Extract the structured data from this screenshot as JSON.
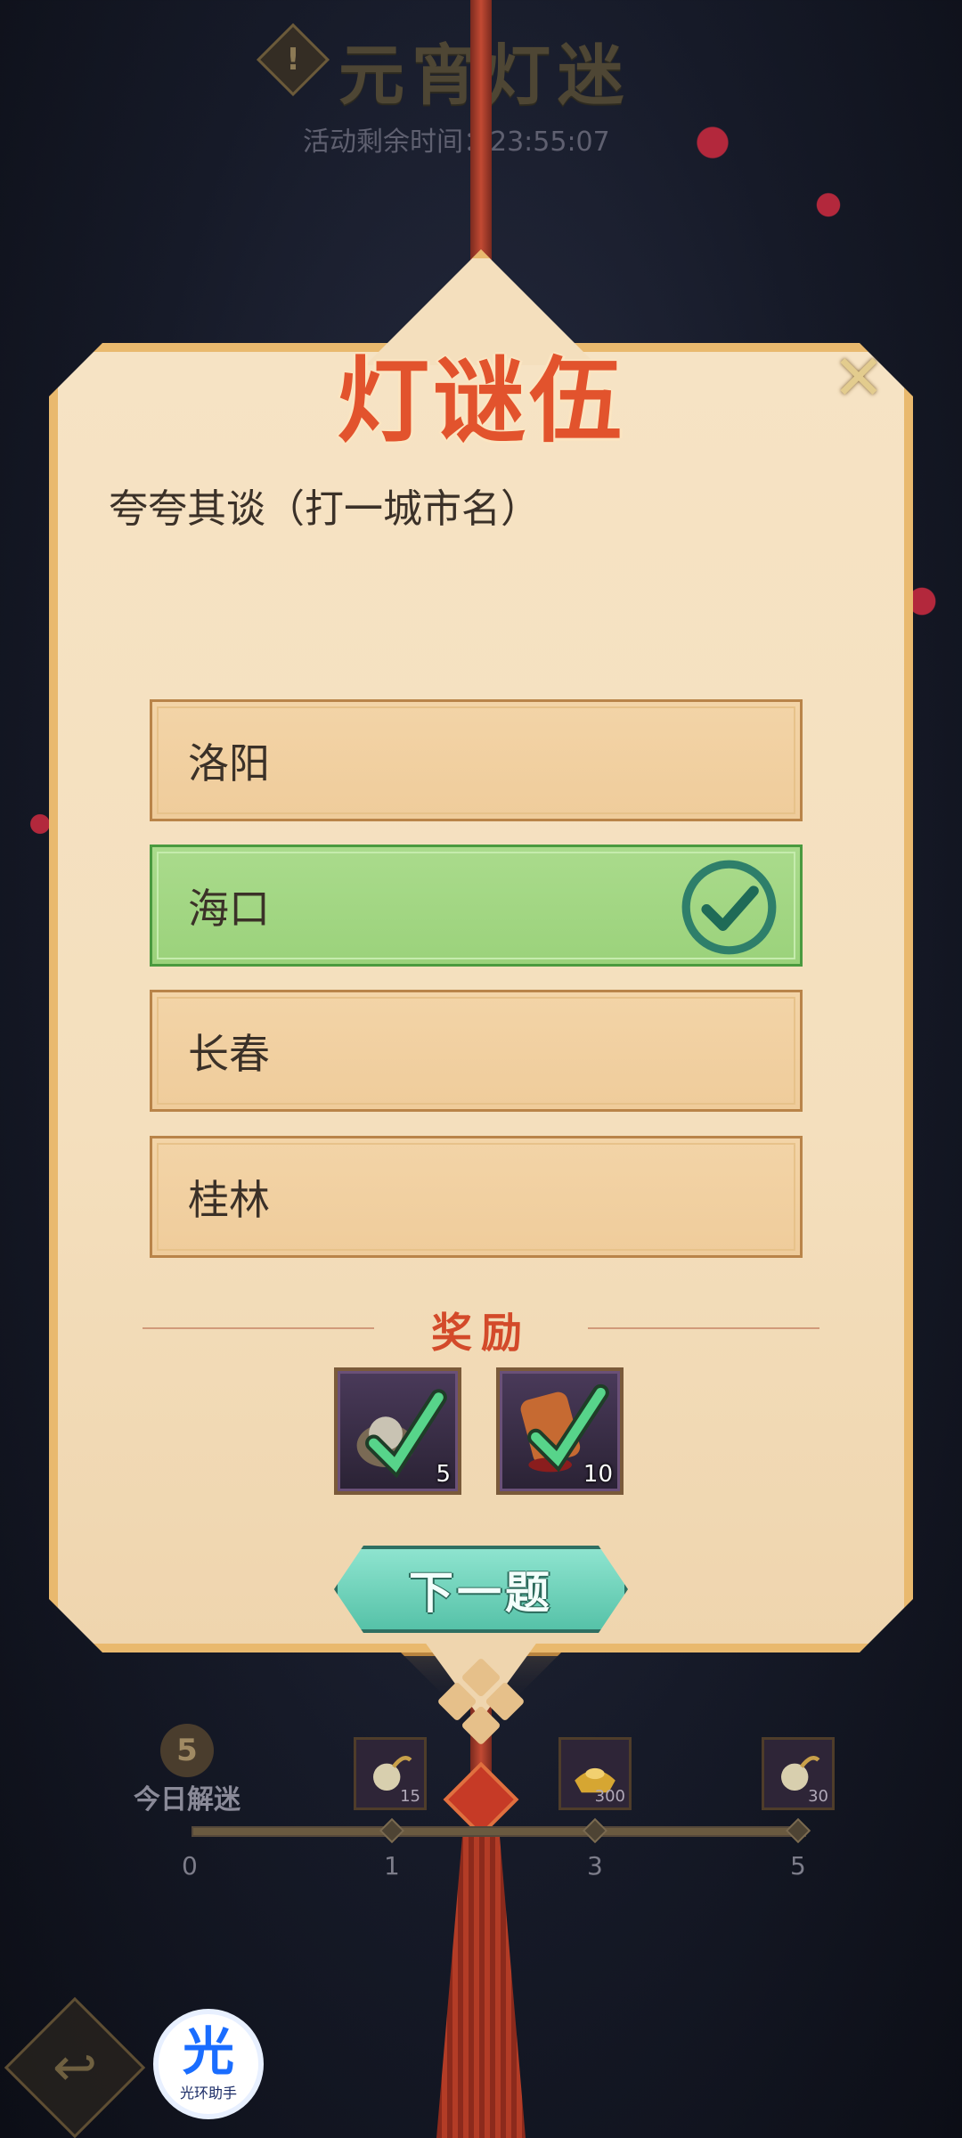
{
  "header": {
    "event_title": "元宵灯迷",
    "timer_text": "活动剩余时间：23:55:07",
    "warn_symbol": "!"
  },
  "card": {
    "puzzle_title": "灯谜伍",
    "close_symbol": "✕",
    "question": "夸夸其谈（打一城市名）",
    "options": [
      {
        "label": "洛阳",
        "state": "normal"
      },
      {
        "label": "海口",
        "state": "correct"
      },
      {
        "label": "长春",
        "state": "normal"
      },
      {
        "label": "桂林",
        "state": "normal"
      }
    ],
    "reward_heading": "奖励",
    "rewards": [
      {
        "icon": "gold-pouch-icon",
        "count": "5",
        "claimed": true
      },
      {
        "icon": "tea-scroll-icon",
        "count": "10",
        "claimed": true
      }
    ],
    "next_label": "下一题"
  },
  "progress": {
    "solved_count": "5",
    "solved_label": "今日解迷",
    "milestones": [
      {
        "icon": "gold-pouch-icon",
        "count": "15"
      },
      {
        "icon": "gold-ingot-icon",
        "count": "300"
      },
      {
        "icon": "gold-pouch-icon",
        "count": "30"
      }
    ],
    "ticks": [
      "0",
      "1",
      "3",
      "5"
    ],
    "value": 5,
    "max": 5
  },
  "footer": {
    "back_symbol": "↩",
    "assistant_glyph": "光",
    "assistant_label": "光环助手"
  },
  "colors": {
    "accent_red": "#e2532d",
    "correct_green": "#9bd27b",
    "button_teal": "#56c2a8",
    "card_bg": "#f4dfbd"
  }
}
